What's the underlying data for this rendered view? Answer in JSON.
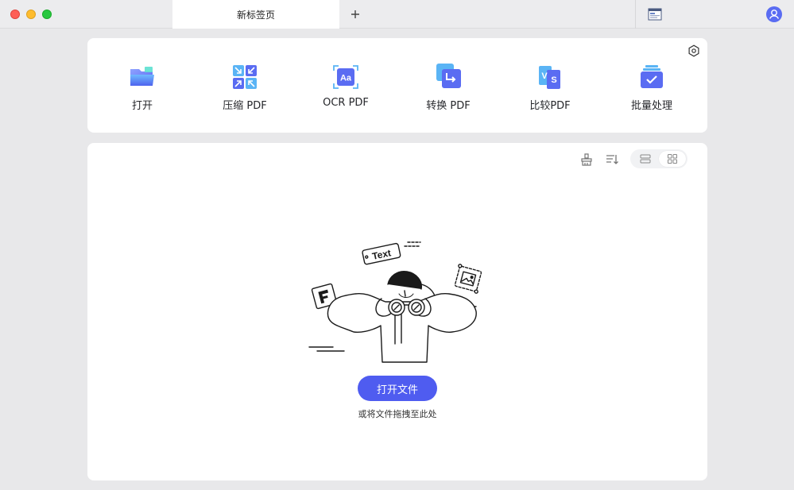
{
  "titlebar": {
    "tab_title": "新标签页"
  },
  "tools": [
    {
      "label": "打开",
      "icon": "folder-icon"
    },
    {
      "label": "压缩 PDF",
      "icon": "compress-icon"
    },
    {
      "label": "OCR PDF",
      "icon": "ocr-icon"
    },
    {
      "label": "转换 PDF",
      "icon": "convert-icon"
    },
    {
      "label": "比较PDF",
      "icon": "compare-icon"
    },
    {
      "label": "批量处理",
      "icon": "batch-icon"
    }
  ],
  "main": {
    "illustration_text": "Text",
    "open_button_label": "打开文件",
    "drop_hint": "或将文件拖拽至此处"
  },
  "colors": {
    "accent": "#4f5cf0",
    "background": "#e8e8ea",
    "card": "#ffffff"
  }
}
